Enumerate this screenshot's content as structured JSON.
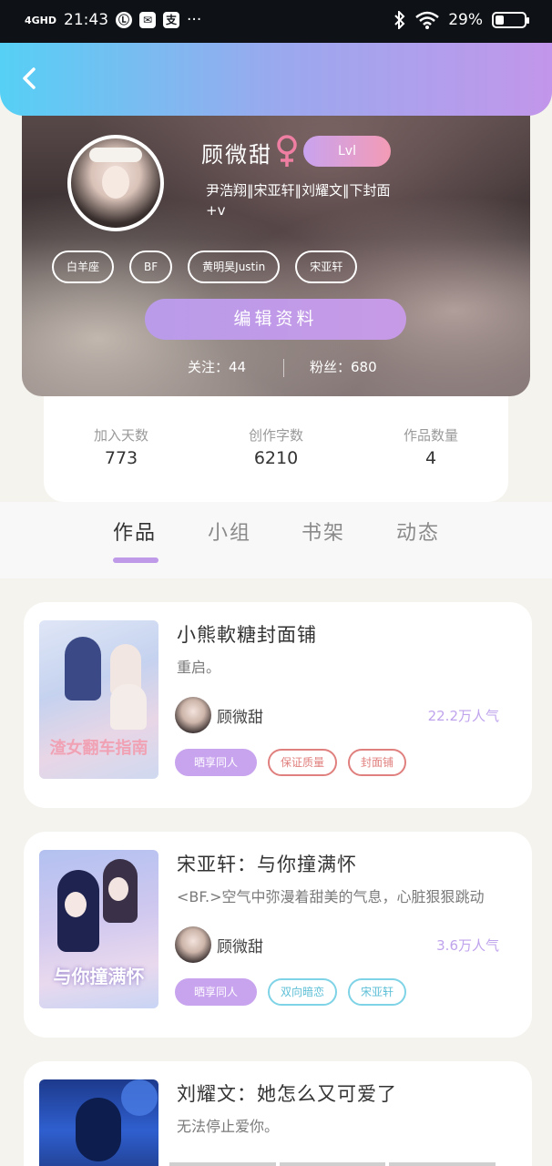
{
  "status_bar": {
    "signal": "4GHD",
    "time": "21:43",
    "app_icon_1": "Ⓛ",
    "app_icon_2": "✉",
    "app_icon_3": "支",
    "more": "···",
    "battery_percent": "29%",
    "battery_level": 0.29
  },
  "header": {
    "back_icon": "chevron-left-icon"
  },
  "profile": {
    "name": "顾微甜",
    "gender_icon": "female-icon",
    "level": "Lvl",
    "bio": "尹浩翔‖宋亚轩‖刘耀文‖下封面+v",
    "tags": [
      "白羊座",
      "BF",
      "黄明昊Justin",
      "宋亚轩"
    ],
    "edit_button": "编辑资料",
    "following_label": "关注：44",
    "followers_label": "粉丝：680"
  },
  "stats": [
    {
      "label": "加入天数",
      "value": "773"
    },
    {
      "label": "创作字数",
      "value": "6210"
    },
    {
      "label": "作品数量",
      "value": "4"
    }
  ],
  "tabs": [
    "作品",
    "小组",
    "书架",
    "动态"
  ],
  "active_tab": "作品",
  "works": [
    {
      "title": "小熊軟糖封面铺",
      "desc": "重启。",
      "author": "顾微甜",
      "popularity": "22.2万人气",
      "popularity_color": "#bfa3ec",
      "tags": [
        {
          "label": "晒享同人",
          "style": "solid"
        },
        {
          "label": "保证质量",
          "style": "red"
        },
        {
          "label": "封面铺",
          "style": "red"
        }
      ],
      "cover_text": "渣女翻车指南"
    },
    {
      "title": "宋亚轩：与你撞满怀",
      "desc": "<BF.>空气中弥漫着甜美的气息，心脏狠狠跳动",
      "author": "顾微甜",
      "popularity": "3.6万人气",
      "popularity_color": "#bfa3ec",
      "tags": [
        {
          "label": "晒享同人",
          "style": "solid"
        },
        {
          "label": "双向暗恋",
          "style": "cyan"
        },
        {
          "label": "宋亚轩",
          "style": "cyan"
        }
      ],
      "cover_text": "与你撞满怀"
    },
    {
      "title": "刘耀文：她怎么又可爱了",
      "desc": "无法停止爱你。",
      "author": "",
      "popularity": "",
      "popularity_color": "#bfa3ec",
      "tags": [],
      "cover_text": ""
    }
  ],
  "colors": {
    "header_gradient": [
      "#56d0f5",
      "#c296ea"
    ],
    "accent_purple": "#c8a3ee",
    "tag_red": "#e0807e",
    "tag_cyan": "#7fd3e6"
  }
}
